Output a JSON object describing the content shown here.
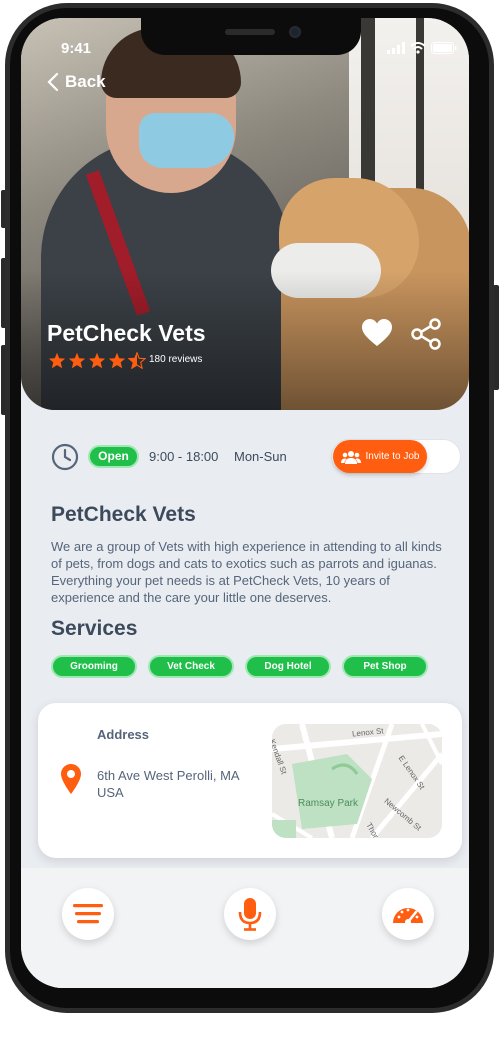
{
  "status_bar": {
    "time": "9:41"
  },
  "header": {
    "back_label": "Back"
  },
  "business": {
    "name": "PetCheck Vets",
    "rating": 4.5,
    "reviews": "180 reviews"
  },
  "hours": {
    "status": "Open",
    "time_range": "9:00 - 18:00",
    "days": "Mon-Sun"
  },
  "invite": {
    "label": "Invite to Job"
  },
  "about": {
    "title": "PetCheck Vets",
    "description": "We are a group of Vets with high experience in attending to all kinds of pets, from dogs and cats to exotics such as parrots and iguanas. Everything your pet needs is at PetCheck Vets, 10 years of experience and the care your little one deserves."
  },
  "services": {
    "title": "Services",
    "items": [
      "Grooming",
      "Vet Check",
      "Dog Hotel",
      "Pet Shop"
    ]
  },
  "address": {
    "label": "Address",
    "value": "6th Ave West Perolli, MA USA",
    "map_streets": [
      "Kendall St",
      "Lenox St",
      "E Lenox St",
      "Newcomb St",
      "Thor"
    ],
    "map_park": "Ramsay Park"
  },
  "colors": {
    "accent": "#ff5d0f",
    "success": "#1fbf4a",
    "text": "#3d4a5c"
  },
  "nav": {
    "icons": [
      "menu-icon",
      "microphone-icon",
      "speedometer-icon"
    ]
  }
}
